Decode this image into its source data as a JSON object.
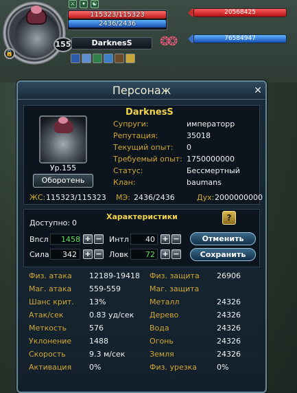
{
  "hud": {
    "hp": "115323/115323",
    "mp": "2436/2436",
    "level": "155",
    "name": "DarknesS",
    "target_hp": "20568425",
    "target_mp": "76584947"
  },
  "panel": {
    "title": "Персонаж",
    "close": "✕"
  },
  "character": {
    "name": "DarknesS",
    "level_text": "Ур.155",
    "class_button": "Оборотень",
    "info": [
      {
        "label": "Супруги:",
        "value": "императорр"
      },
      {
        "label": "Репутация:",
        "value": "35018"
      },
      {
        "label": "Текущий опыт:",
        "value": "0"
      },
      {
        "label": "Требуемый опыт:",
        "value": "1750000000"
      },
      {
        "label": "Статус:",
        "value": "Бессмертный"
      },
      {
        "label": "Клан:",
        "value": "baumans"
      }
    ],
    "hp_label": "ЖС:",
    "hp_value": "115323/115323",
    "mp_label": "МЭ:",
    "mp_value": "2436/2436",
    "spirit_label": "Дух:",
    "spirit_value": "2000000000"
  },
  "stats": {
    "header": "Характеристики",
    "available_label": "Доступно:",
    "available_value": "0",
    "help": "?",
    "vit_label": "Вncл",
    "vit_value": "1458",
    "int_label": "Интл",
    "int_value": "40",
    "str_label": "Сила",
    "str_value": "342",
    "dex_label": "Ловк",
    "dex_value": "72",
    "plus": "+",
    "minus": "−",
    "cancel": "Отменить",
    "save": "Сохранить"
  },
  "table": [
    {
      "l1": "Физ. атака",
      "v1": "12189-19418",
      "l2": "Физ. защита",
      "v2": "26906"
    },
    {
      "l1": "Маг. атака",
      "v1": "559-559",
      "l2": "Маг. защита",
      "v2": ""
    },
    {
      "l1": "Шанс крит.",
      "v1": "13%",
      "l2": "Металл",
      "v2": "24326"
    },
    {
      "l1": "Атак/сек",
      "v1": "0.83 уд/сек",
      "l2": "Дерево",
      "v2": "24326"
    },
    {
      "l1": "Меткость",
      "v1": "576",
      "l2": "Вода",
      "v2": "24326"
    },
    {
      "l1": "Уклонение",
      "v1": "1488",
      "l2": "Огонь",
      "v2": "24326"
    },
    {
      "l1": "Скорость",
      "v1": "9.3 м/сек",
      "l2": "Земля",
      "v2": "24326"
    },
    {
      "l1": "Активация",
      "v1": "0%",
      "l2": "Физ. урезка",
      "v2": "0%"
    }
  ]
}
